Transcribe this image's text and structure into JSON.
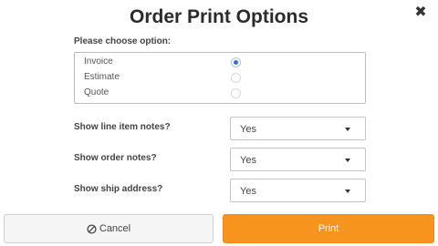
{
  "dialog": {
    "title": "Order Print Options",
    "close_label": "✖"
  },
  "options": {
    "prompt": "Please choose option:",
    "items": [
      {
        "label": "Invoice",
        "selected": true
      },
      {
        "label": "Estimate",
        "selected": false
      },
      {
        "label": "Quote",
        "selected": false
      }
    ]
  },
  "settings": [
    {
      "label": "Show line item notes?",
      "value": "Yes"
    },
    {
      "label": "Show order notes?",
      "value": "Yes"
    },
    {
      "label": "Show ship address?",
      "value": "Yes"
    }
  ],
  "buttons": {
    "cancel": {
      "label": "Cancel",
      "icon": "ban-icon"
    },
    "print": {
      "label": "Print"
    }
  },
  "colors": {
    "accent": "#f7941d",
    "radio_selected": "#3a6fc4"
  }
}
